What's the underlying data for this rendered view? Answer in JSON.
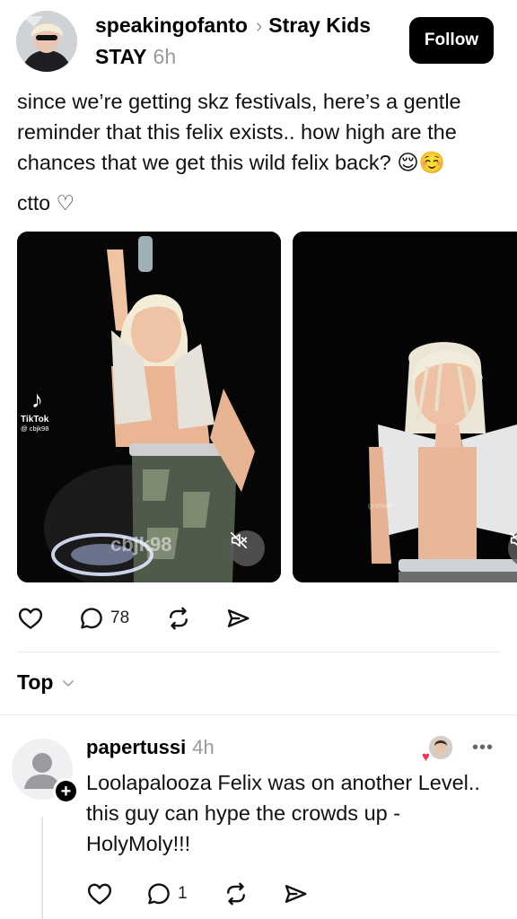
{
  "post": {
    "author": "speakingofanto",
    "topic": "Stray Kids",
    "community": "STAY",
    "time": "6h",
    "follow_label": "Follow",
    "text": "since we’re getting skz festivals, here’s a gentle reminder that this felix exists.. how high are the chances that we get this wild felix back? 😌☺️",
    "ctto": "ctto ♡",
    "media": [
      {
        "watermark_app": "TikTok",
        "watermark_handle": "@ cbjk98",
        "watermark_overlay": "cbjk98"
      },
      {
        "watermark_overlay": "gromelli"
      }
    ],
    "actions": {
      "likes": "",
      "replies": "78",
      "reposts": "",
      "shares": ""
    }
  },
  "sort": {
    "label": "Top"
  },
  "reply": {
    "author": "papertussi",
    "time": "4h",
    "more": "•••",
    "text": "Loolapalooza Felix was on another Level.. this guy can hype the crowds up - HolyMoly!!!",
    "actions": {
      "replies": "1"
    }
  },
  "colors": {
    "accent": "#000000",
    "muted": "#999999",
    "like_heart": "#ff2d55"
  },
  "icons": [
    "heart-icon",
    "comment-icon",
    "repost-icon",
    "share-icon",
    "mute-icon",
    "chevron-right-icon",
    "chevron-down-icon",
    "plus-icon",
    "tiktok-icon"
  ]
}
